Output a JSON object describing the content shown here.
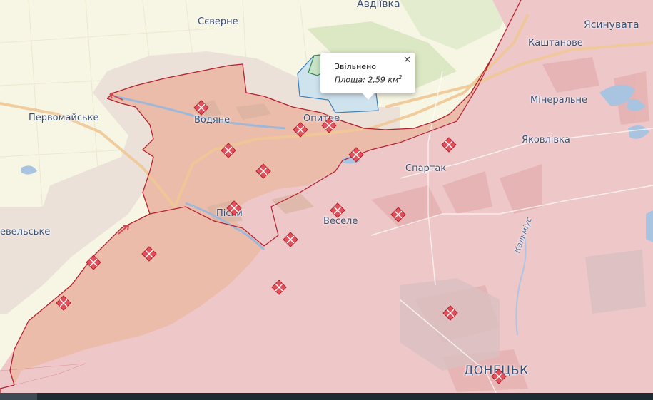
{
  "map": {
    "places": {
      "avdiivka": "Авдіївка",
      "sieverne": "Сєверне",
      "yasynuvata": "Ясинувата",
      "kashtanove": "Каштанове",
      "mineralne": "Мінеральне",
      "pervomaiske": "Первомайське",
      "vodiane": "Водяне",
      "opytne": "Опитне",
      "yakovlivka": "Яковлівка",
      "spartak": "Спартак",
      "pisky": "Піски",
      "vesele": "Веселе",
      "nevelske": "евельське",
      "kalmius": "Кальміус",
      "donetsk": "ДОНЕЦЬК"
    },
    "colors": {
      "occupied_fill": "#eec7c9",
      "contested_fill": "#e9b9a8",
      "liberated_fill": "#cfe3ef",
      "liberated_border": "#3b7fb8",
      "gray_zone_fill": "#ebe3dc",
      "front_line": "#b5202f",
      "marker_color": "#e0525b",
      "green_area": "#dde8c4"
    }
  },
  "popup": {
    "title": "Звільнено",
    "area_label": "Площа: 2,59 км",
    "area_unit_power": "2",
    "close_icon": "✕"
  }
}
